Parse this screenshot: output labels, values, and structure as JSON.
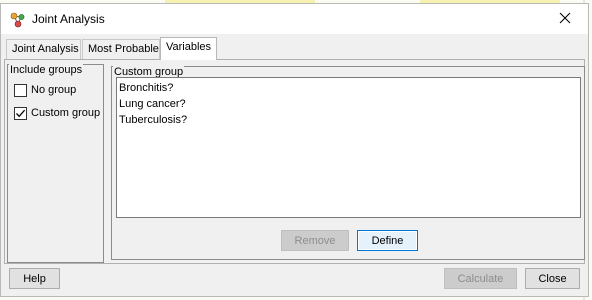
{
  "window": {
    "title": "Joint Analysis"
  },
  "tabs": [
    {
      "label": "Joint Analysis",
      "active": false
    },
    {
      "label": "Most Probable",
      "active": false
    },
    {
      "label": "Variables",
      "active": true
    }
  ],
  "include_groups": {
    "label": "Include groups",
    "options": [
      {
        "label": "No group",
        "checked": false
      },
      {
        "label": "Custom group",
        "checked": true
      }
    ]
  },
  "custom_group": {
    "label": "Custom group",
    "items": [
      "Bronchitis?",
      "Lung cancer?",
      "Tuberculosis?"
    ],
    "remove_label": "Remove",
    "define_label": "Define"
  },
  "footer": {
    "help_label": "Help",
    "calculate_label": "Calculate",
    "close_label": "Close"
  },
  "icons": {
    "app": "network-graph-icon",
    "close": "close-icon",
    "check": "checkmark-icon"
  },
  "colors": {
    "focus_border": "#0078d7"
  }
}
